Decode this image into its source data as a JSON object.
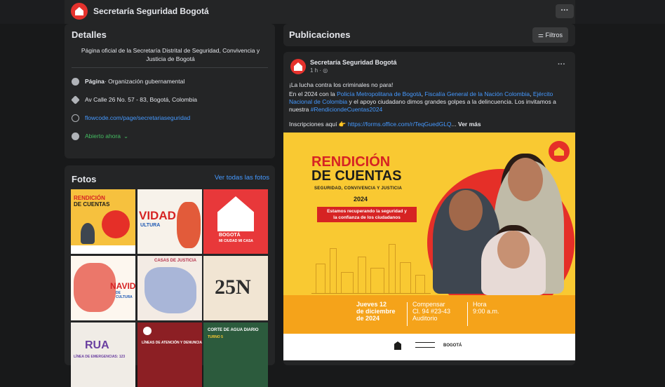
{
  "header": {
    "page_name": "Secretaría Seguridad Bogotá",
    "more_label": "···"
  },
  "details": {
    "title": "Detalles",
    "description": "Página oficial de la Secretaría Distrital de Seguridad, Convivencia y Justicia de Bogotá",
    "category_prefix": "Página",
    "category": " · Organización gubernamental",
    "address": "Av Calle 26 No. 57 - 83, Bogotá, Colombia",
    "website": "flowcode.com/page/secretariaseguridad",
    "hours": "Abierto ahora",
    "hours_chevron": "⌄"
  },
  "photos": {
    "title": "Fotos",
    "see_all": "Ver todas las fotos",
    "thumbs": [
      {
        "line1": "RENDICIÓN",
        "line2": "DE CUENTAS"
      },
      {
        "line1": "VIDAD",
        "line2": "ULTURA"
      },
      {
        "line1": "BOGOTÁ",
        "line2": "MI CIUDAD MI CASA"
      },
      {
        "line1": "NAVID",
        "line2": "DE CULTURA"
      },
      {
        "line1": "CASAS DE JUSTICIA",
        "line2": ""
      },
      {
        "line1": "25N",
        "line2": ""
      },
      {
        "line1": "RUA",
        "line2": "LÍNEA DE EMERGENCIAS: 123"
      },
      {
        "line1": "LÍNEAS DE ATENCIÓN Y DENUNCIA",
        "line2": ""
      },
      {
        "line1": "CORTE DE AGUA DIARIO",
        "line2": "TURNO 5"
      }
    ]
  },
  "publications": {
    "title": "Publicaciones",
    "filters_label": "⚌ Filtros"
  },
  "post": {
    "author": "Secretaría Seguridad Bogotá",
    "time": "1 h · ◎",
    "more": "···",
    "line1": "¡La lucha contra los criminales no para!",
    "p2_a": "En el 2024 con la ",
    "p2_link1": "Policía Metropolitana de Bogotá",
    "p2_b": ", ",
    "p2_link2": "Fiscalía General de la Nación Colombia",
    "p2_c": ",",
    "p2_link3": "Ejército Nacional de Colombia",
    "p2_d": " y el apoyo ciudadano dimos grandes golpes a la delincuencia. Los invitamos a nuestra ",
    "p2_hashtag": "#RendiciondeCuentas2024",
    "p3_a": "Inscripciones aquí 👉 ",
    "p3_link": "https://forms.office.com/r/TeqGuedGLQ",
    "p3_b": "... ",
    "p3_seemore": "Ver más"
  },
  "poster": {
    "title1": "RENDICIÓN",
    "title2": "DE CUENTAS",
    "subtitle": "SEGURIDAD, CONVIVENCIA Y JUSTICIA",
    "year": "2024",
    "ribbon1": "Estamos recuperando la seguridad y",
    "ribbon2": "la confianza de los ciudadanos",
    "date1": "Jueves 12",
    "date2": "de diciembre",
    "date3": "de 2024",
    "place1": "Compensar",
    "place2": "Cl. 94 #23-43",
    "place3": "Auditorio",
    "time1": "Hora",
    "time2": "9:00 a.m.",
    "logo_text": "BOGOTÁ"
  },
  "colors": {
    "background": "#18191a",
    "card": "#242526",
    "link": "#4599ff",
    "open_green": "#45bd62",
    "poster_yellow": "#f9c932",
    "poster_red": "#e52f28"
  }
}
